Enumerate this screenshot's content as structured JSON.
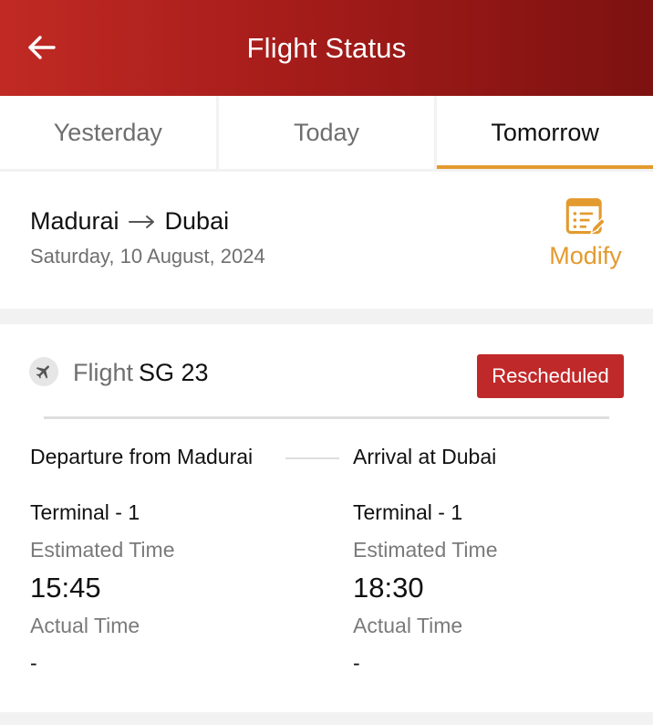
{
  "header": {
    "title": "Flight Status",
    "back_icon": "arrow-left-icon"
  },
  "tabs": [
    {
      "label": "Yesterday",
      "active": false
    },
    {
      "label": "Today",
      "active": false
    },
    {
      "label": "Tomorrow",
      "active": true
    }
  ],
  "route": {
    "origin": "Madurai",
    "destination": "Dubai",
    "date": "Saturday, 10 August, 2024",
    "modify_label": "Modify",
    "modify_icon": "edit-list-icon"
  },
  "flight": {
    "prefix": "Flight",
    "number": "SG 23",
    "status": "Rescheduled",
    "icon": "plane-icon",
    "departure": {
      "title": "Departure from Madurai",
      "terminal": "Terminal - 1",
      "estimated_label": "Estimated Time",
      "estimated_time": "15:45",
      "actual_label": "Actual Time",
      "actual_time": "-"
    },
    "arrival": {
      "title": "Arrival at Dubai",
      "terminal": "Terminal - 1",
      "estimated_label": "Estimated Time",
      "estimated_time": "18:30",
      "actual_label": "Actual Time",
      "actual_time": "-"
    }
  },
  "colors": {
    "header_start": "#c12a24",
    "header_end": "#7c1210",
    "accent": "#e39a2e",
    "status": "#c0292a"
  }
}
